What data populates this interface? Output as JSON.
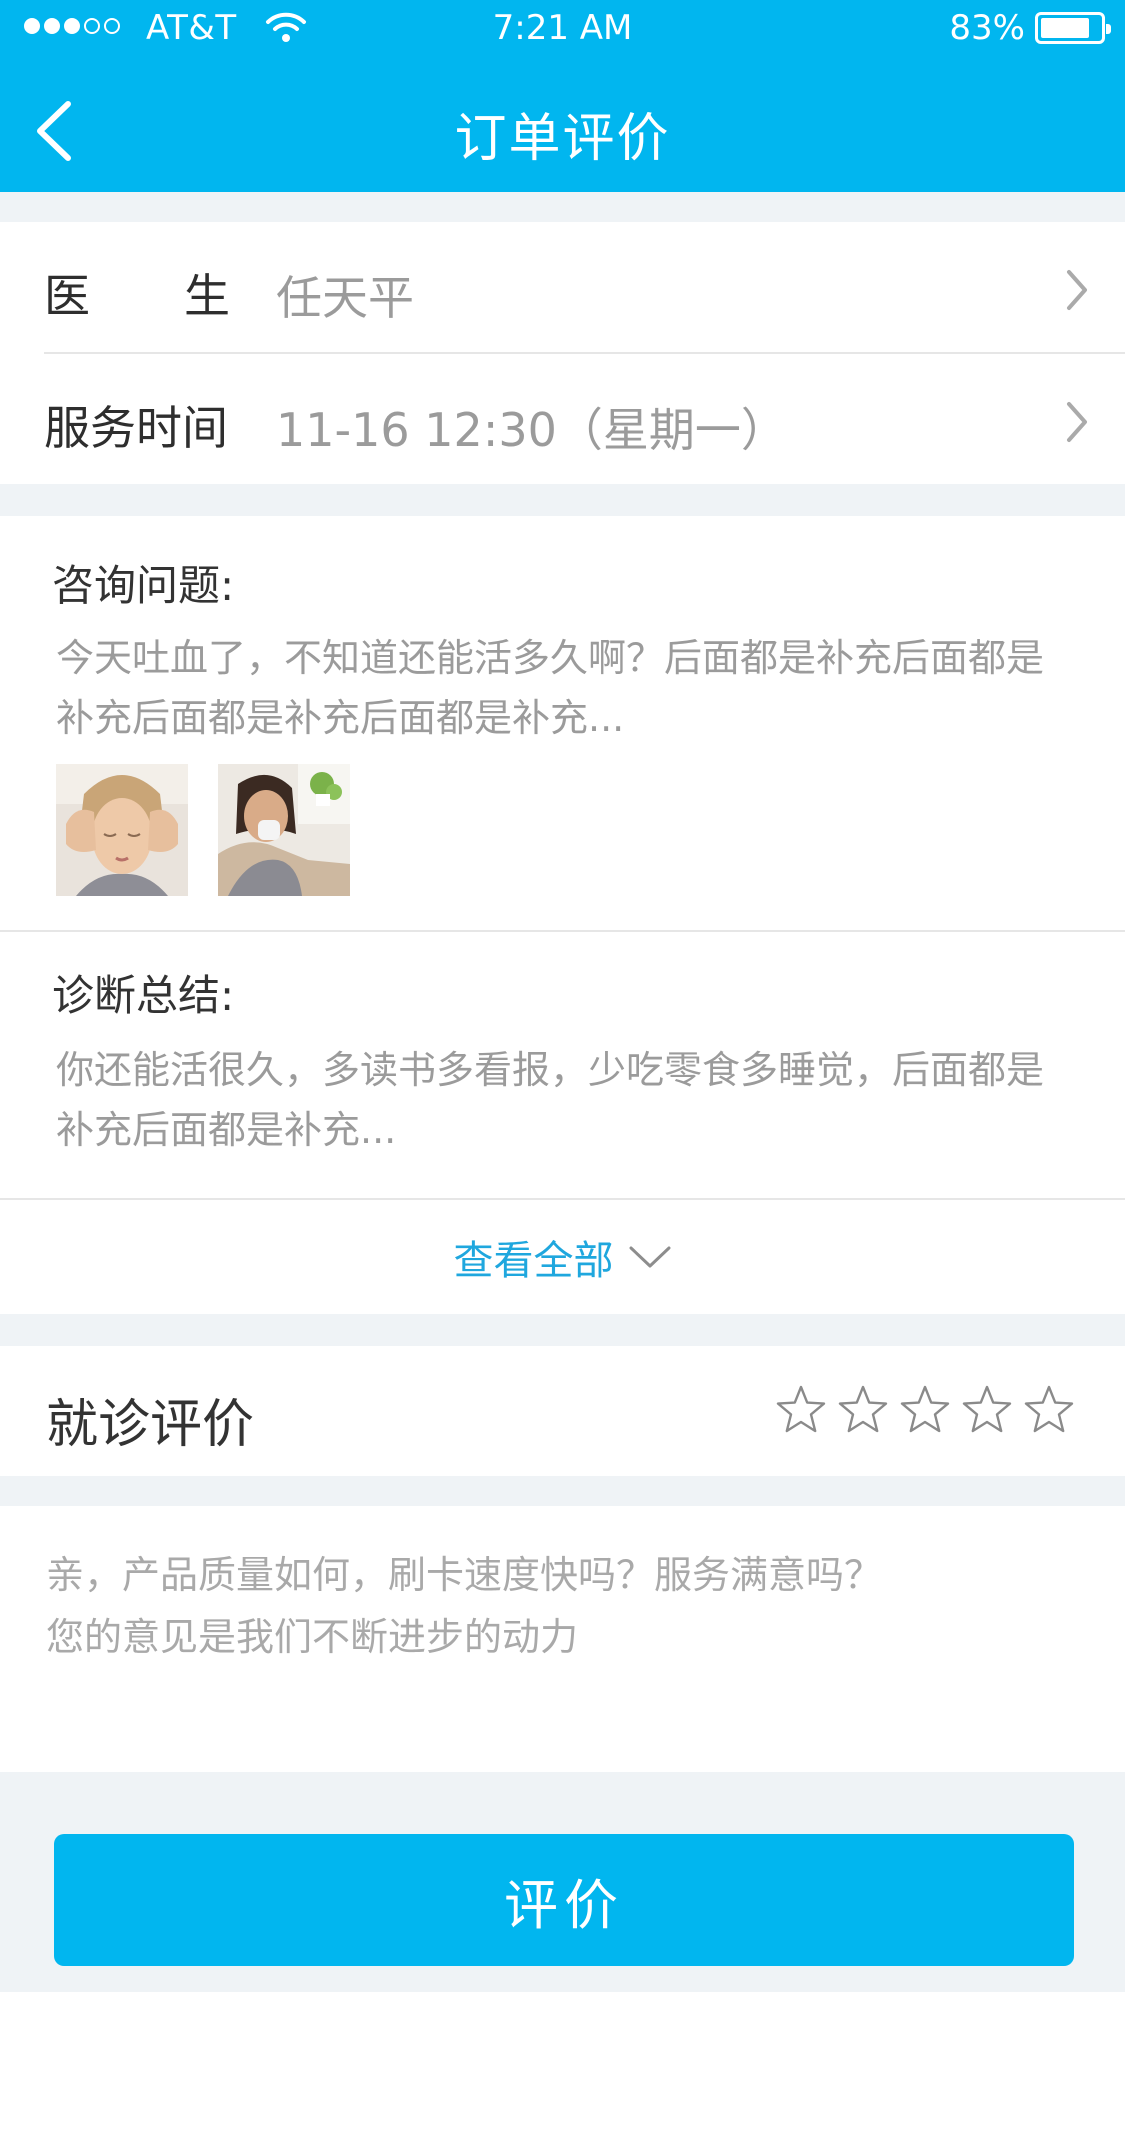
{
  "status_bar": {
    "carrier": "AT&T",
    "time": "7:21 AM",
    "battery_pct": "83%",
    "battery_level": 0.83,
    "signal_bars": 3,
    "signal_total": 5,
    "icons": [
      "signal-dots-icon",
      "wifi-icon",
      "battery-icon"
    ]
  },
  "nav": {
    "title": "订单评价",
    "back_icon": "chevron-left-icon"
  },
  "info": {
    "doctor_label": "医生",
    "doctor_value": "任天平",
    "time_label": "服务时间",
    "time_value": "11-16  12:30（星期一）"
  },
  "consult": {
    "title": "咨询问题:",
    "text": "今天吐血了，不知道还能活多久啊？后面都是补充后面都是补充后面都是补充后面都是补充...",
    "images": [
      "headache-photo",
      "sick-woman-photo"
    ]
  },
  "diagnosis": {
    "title": "诊断总结:",
    "text": "你还能活很久，多读书多看报，少吃零食多睡觉，后面都是补充后面都是补充..."
  },
  "view_all": {
    "label": "查看全部",
    "icon": "chevron-down-icon"
  },
  "rating": {
    "label": "就诊评价",
    "max_stars": 5,
    "value": 0
  },
  "feedback": {
    "placeholder": "亲，产品质量如何，刷卡速度快吗？服务满意吗？\n您的意见是我们不断进步的动力"
  },
  "submit": {
    "label": "评价"
  },
  "colors": {
    "brand": "#01b6ef",
    "link": "#1fa7de",
    "background_gap": "#eff3f6",
    "text_primary": "#333333",
    "text_secondary": "#9b9b9b"
  }
}
